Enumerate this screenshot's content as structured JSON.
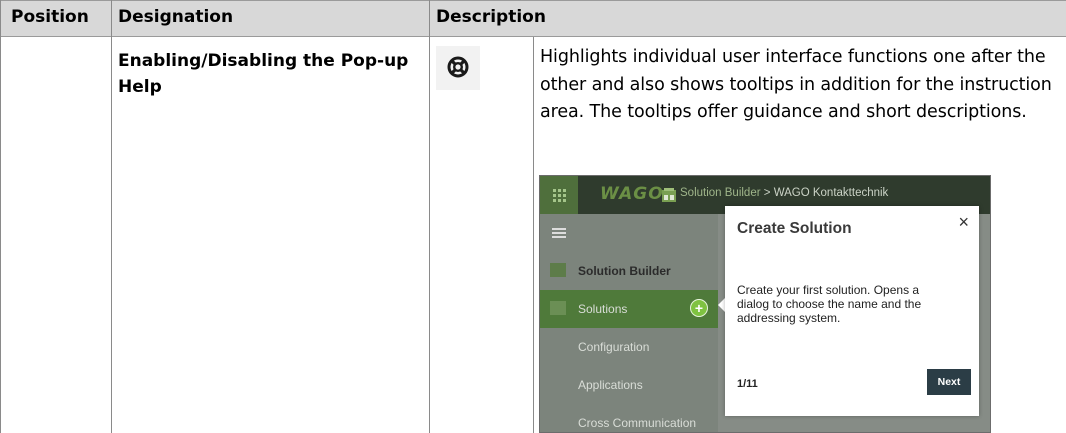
{
  "table": {
    "headers": [
      "Position",
      "Designation",
      "Description"
    ],
    "row": {
      "position": "",
      "designation": "Enabling/Disabling the Pop-up Help",
      "description": "Highlights individual user interface functions one after the other and also shows tooltips in addition for the in­struction area. The tooltips offer guidance and short de­scriptions."
    }
  },
  "icons": {
    "help": "lifebuoy-icon"
  },
  "screenshot": {
    "logo": "WAGO",
    "breadcrumb": {
      "app": "Solution Builder",
      "separator": ">",
      "location": "WAGO Kontakttechnik"
    },
    "sidebar": {
      "header": "Solution Builder",
      "items": [
        "Solutions",
        "Configuration",
        "Applications",
        "Cross Communication"
      ]
    },
    "popup": {
      "title": "Create Solution",
      "close": "×",
      "body": "Create your first solution. Opens a dialog to choose the name and the addressing system.",
      "step": "1/11",
      "next_label": "Next"
    },
    "colors": {
      "accent_green": "#7fc241",
      "next_button": "#2b3d46"
    }
  }
}
